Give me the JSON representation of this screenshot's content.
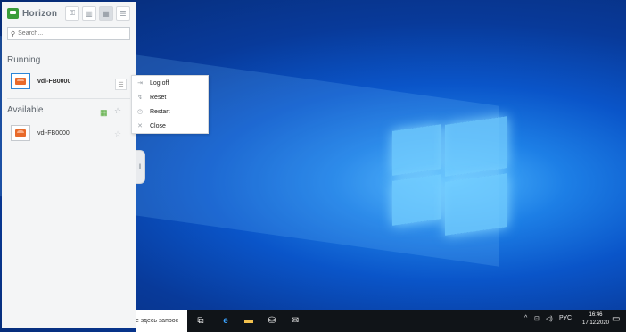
{
  "app": {
    "brand": "Horizon"
  },
  "search": {
    "placeholder": "Search..."
  },
  "sections": {
    "running": "Running",
    "available": "Available"
  },
  "running_items": [
    {
      "label": "vdi-FB0000"
    }
  ],
  "available_items": [
    {
      "label": "vdi-FB0000"
    }
  ],
  "context_menu": {
    "items": [
      "Log off",
      "Reset",
      "Restart",
      "Close"
    ]
  },
  "taskbar": {
    "search_text": "е здесь запрос",
    "language": "РУС",
    "time": "16:46",
    "date": "17.12.2020"
  },
  "colors": {
    "accent": "#2b86d8",
    "brand": "#3a9d3a",
    "taskbar": "#101418"
  }
}
